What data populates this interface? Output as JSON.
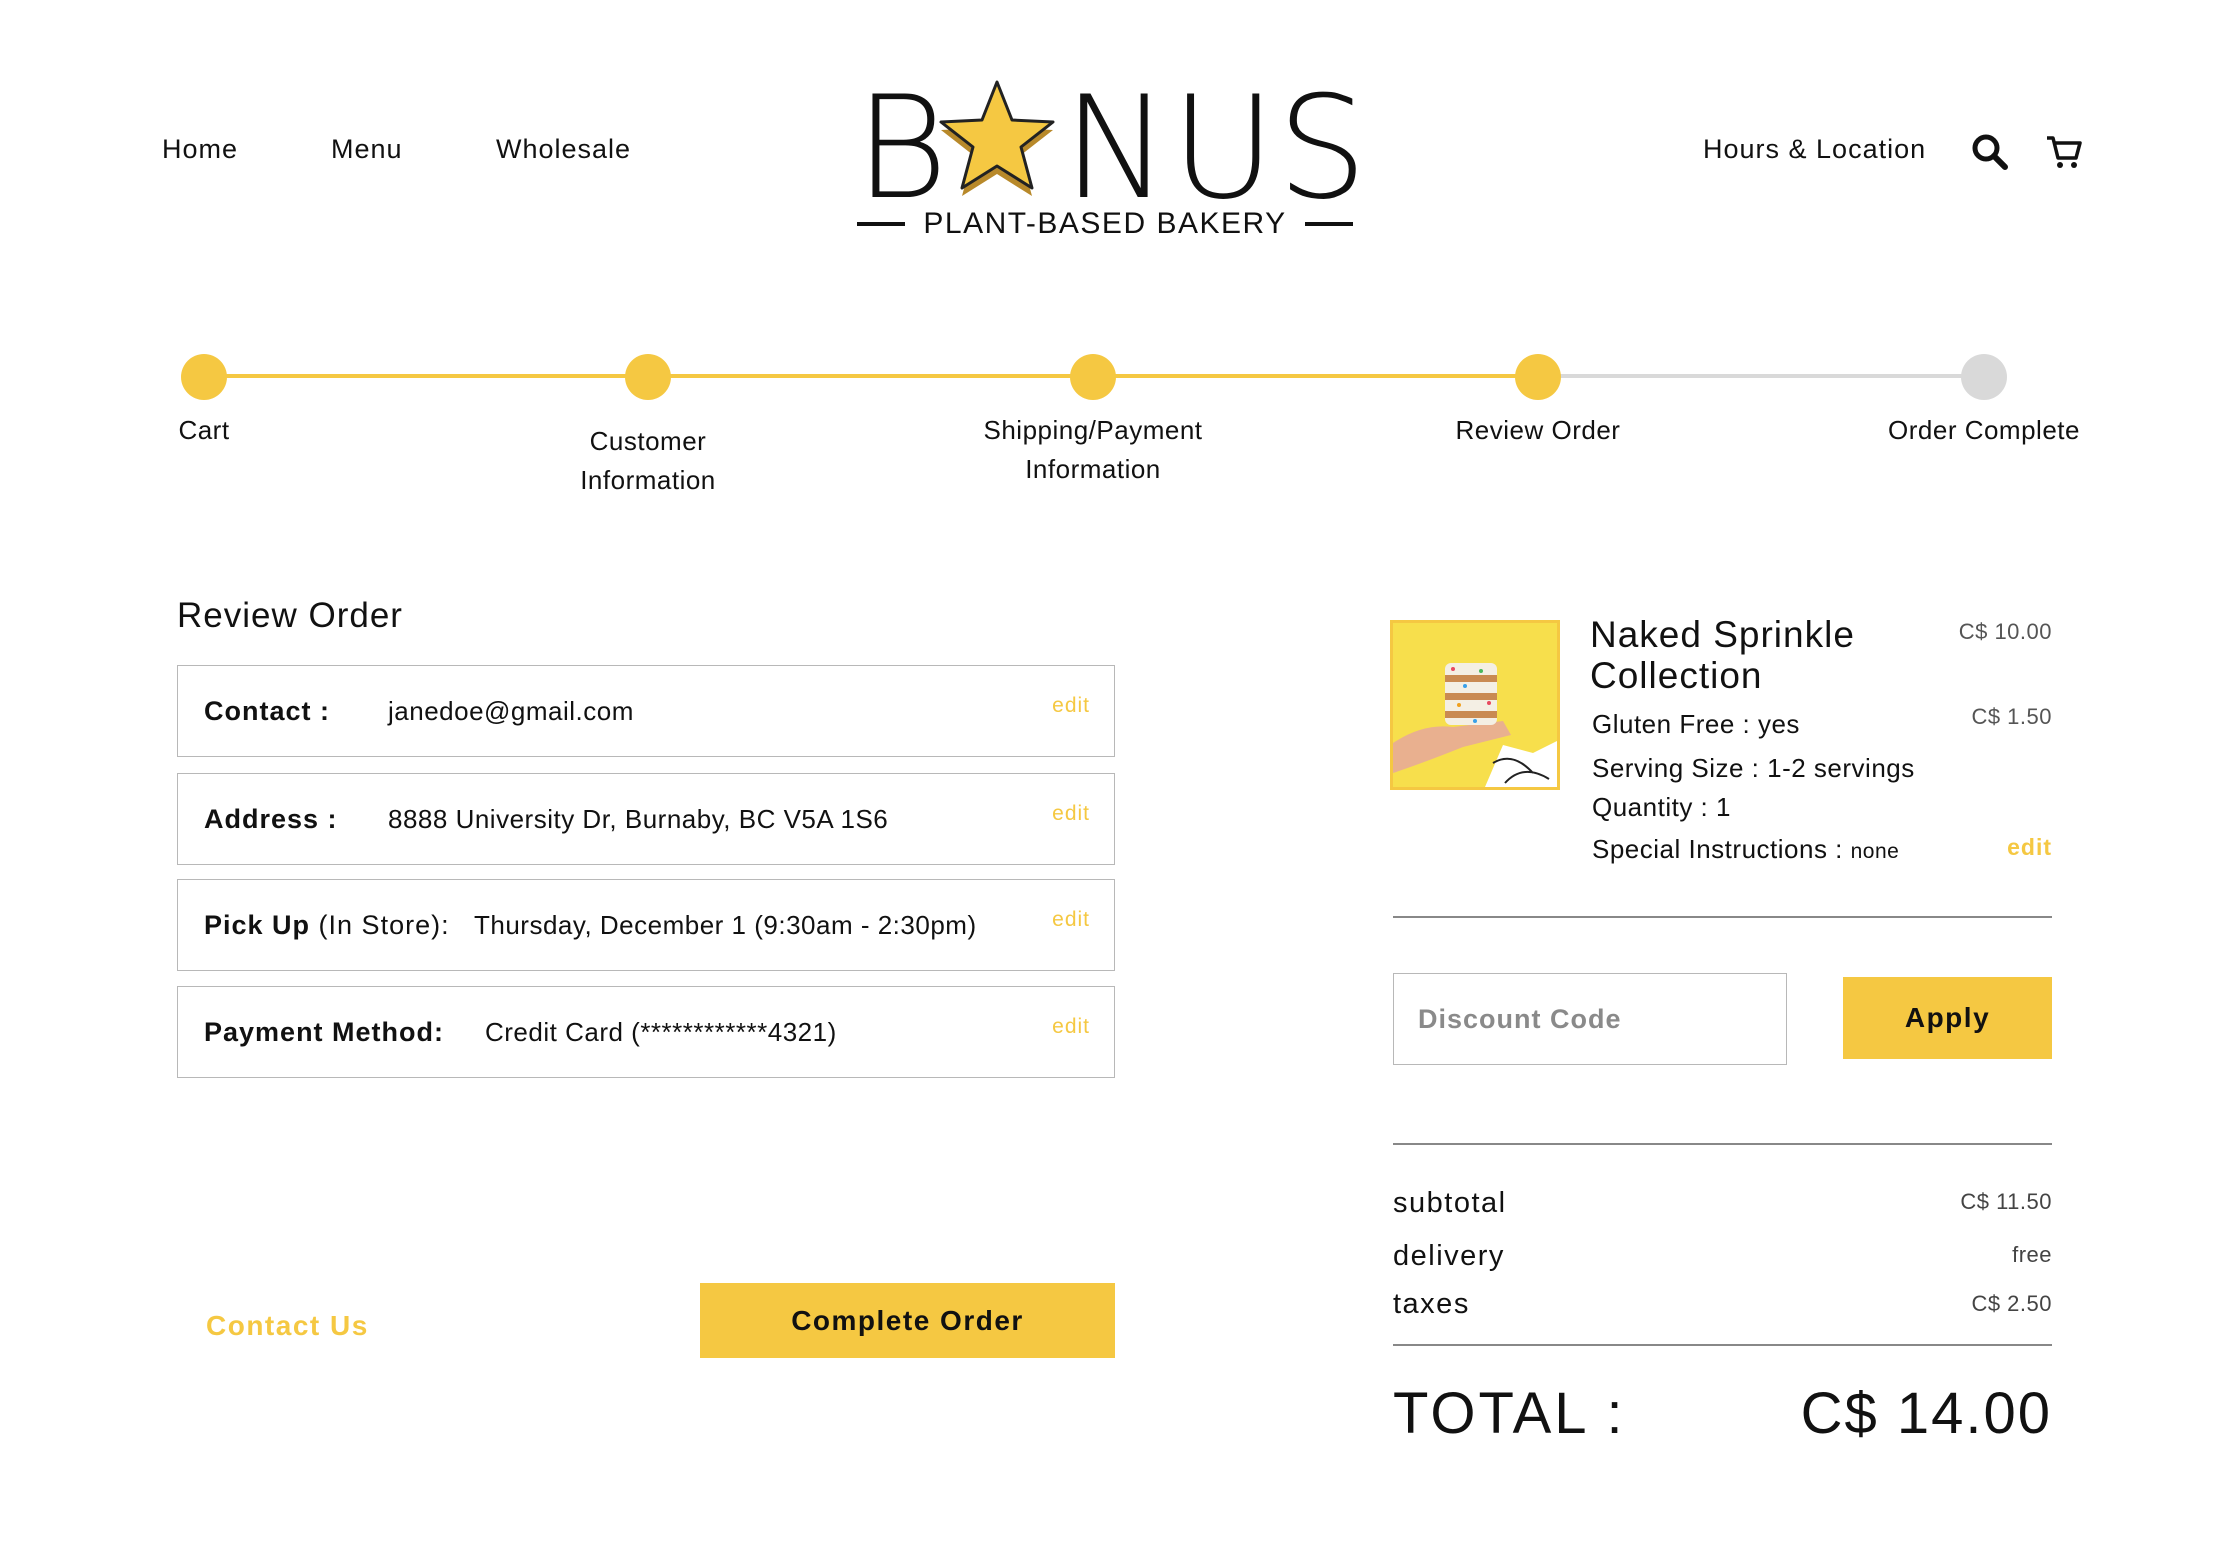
{
  "nav": {
    "left": [
      "Home",
      "Menu",
      "Wholesale"
    ],
    "right_link": "Hours & Location",
    "search_icon": "search-icon",
    "cart_icon": "cart-icon"
  },
  "brand": {
    "name_left": "B",
    "name_right": "NUS",
    "tagline": "PLANT-BASED BAKERY",
    "accent": "#f5c842"
  },
  "progress": {
    "active_color": "#f5c842",
    "inactive_color": "#d9d9d9",
    "steps": [
      {
        "label_lines": [
          "Cart"
        ],
        "complete": true
      },
      {
        "label_lines": [
          "Customer",
          "Information"
        ],
        "complete": true
      },
      {
        "label_lines": [
          "Shipping/Payment",
          "Information"
        ],
        "complete": true
      },
      {
        "label_lines": [
          "Review Order"
        ],
        "complete": true
      },
      {
        "label_lines": [
          "Order Complete"
        ],
        "complete": false
      }
    ]
  },
  "review": {
    "title": "Review Order",
    "edit_label": "edit",
    "rows": [
      {
        "label": "Contact :",
        "note": "",
        "value": "janedoe@gmail.com"
      },
      {
        "label": "Address :",
        "note": "",
        "value": "8888 University Dr, Burnaby, BC V5A 1S6"
      },
      {
        "label": "Pick Up",
        "note": " (In Store):",
        "value": "Thursday, December 1 (9:30am - 2:30pm)"
      },
      {
        "label": "Payment Method:",
        "note": "",
        "value": "Credit Card (************4321)"
      }
    ],
    "contact_link": "Contact Us",
    "complete_button": "Complete Order"
  },
  "order": {
    "product": {
      "title_lines": [
        "Naked Sprinkle",
        "Collection"
      ],
      "price": "C$ 10.00",
      "gluten_free": "Gluten Free : yes",
      "gluten_free_price": "C$ 1.50",
      "serving_size": "Serving Size : 1-2 servings",
      "quantity": "Quantity : 1",
      "special_label": "Special Instructions :",
      "special_value": "none",
      "edit_label": "edit"
    },
    "discount": {
      "placeholder": "Discount Code",
      "apply_label": "Apply"
    },
    "summary": {
      "subtotal_label": "subtotal",
      "subtotal_value": "C$ 11.50",
      "delivery_label": "delivery",
      "delivery_value": "free",
      "taxes_label": "taxes",
      "taxes_value": "C$ 2.50",
      "total_label": "TOTAL :",
      "total_value": "C$ 14.00"
    }
  }
}
